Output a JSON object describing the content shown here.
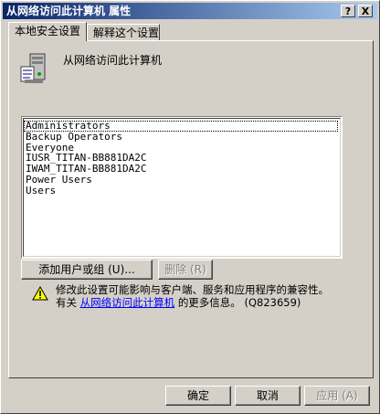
{
  "window": {
    "title": "从网络访问此计算机 属性"
  },
  "titlebar_buttons": {
    "help": "?",
    "close": "X"
  },
  "tabs": [
    {
      "label": "本地安全设置",
      "active": true
    },
    {
      "label": "解释这个设置",
      "active": false
    }
  ],
  "policy": {
    "name": "从网络访问此计算机",
    "icon": "server-policy-icon"
  },
  "accounts": [
    "Administrators",
    "Backup Operators",
    "Everyone",
    "IUSR_TITAN-BB881DA2C",
    "IWAM_TITAN-BB881DA2C",
    "Power Users",
    "Users"
  ],
  "buttons": {
    "add": "添加用户或组 (U)...",
    "remove": "删除 (R)",
    "ok": "确定",
    "cancel": "取消",
    "apply": "应用 (A)"
  },
  "warning": {
    "line1": "修改此设置可能影响与客户端、服务和应用程序的兼容性。",
    "prefix": "有关",
    "link": "从网络访问此计算机",
    "suffix": "的更多信息。 (Q823659)",
    "icon": "warning-icon"
  },
  "colors": {
    "title_start": "#0a246a",
    "title_end": "#a6caf0",
    "face": "#d4d0c8",
    "link": "#0000ff"
  }
}
